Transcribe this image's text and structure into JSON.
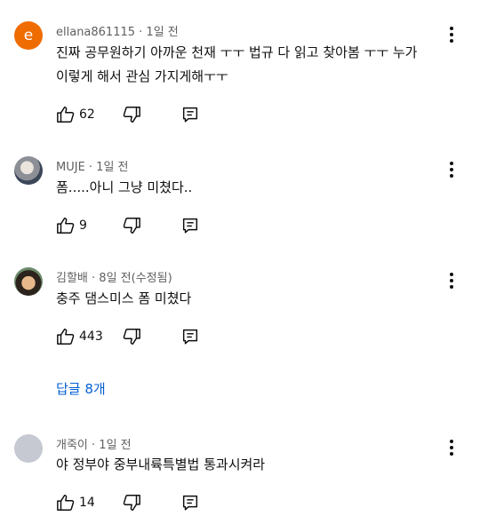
{
  "comments": [
    {
      "author": "ellana861115",
      "time": "· 1일 전",
      "avatar_letter": "e",
      "avatar_color": "#ef6c00",
      "text": "진짜 공무원하기 아까운 천재 ㅜㅜ 법규 다 읽고 찾아봄 ㅜㅜ 누가\n이렇게 해서 관심 가지게해ㅜㅜ",
      "likes": "62"
    },
    {
      "author": "MUJE",
      "time": "· 1일 전",
      "text": "폼.....아니 그냥 미쳤다..",
      "likes": "9"
    },
    {
      "author": "김할배",
      "time": "· 8일 전(수정됨)",
      "text": "충주 댐스미스 폼 미쳤다",
      "likes": "443",
      "replies_label": "답글 8개"
    },
    {
      "author": "개죽이",
      "time": "· 1일 전",
      "text": "야 정부야 중부내륙특별법 통과시켜라",
      "likes": "14"
    }
  ],
  "colors": {
    "link": "#065fd4",
    "meta": "#606060",
    "text": "#0f0f0f"
  }
}
